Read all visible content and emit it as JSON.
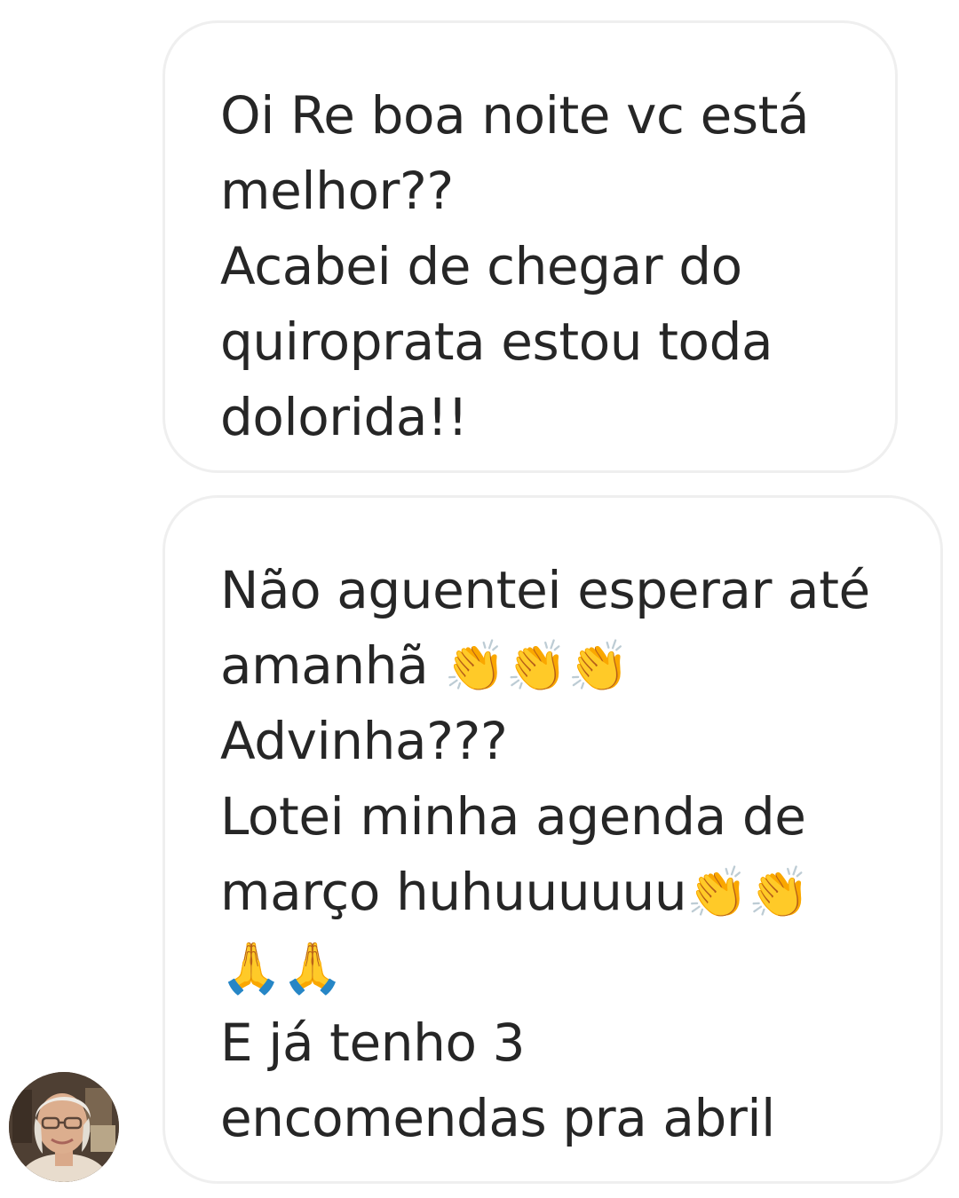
{
  "thread": {
    "messages": [
      {
        "lines": [
          "Oi Re boa noite vc está",
          "melhor??",
          "Acabei de chegar do",
          "quiroprata estou toda",
          "dolorida!!"
        ]
      },
      {
        "lines": [
          "Não aguentei esperar até",
          "amanhã",
          "Advinha???",
          "Lotei minha agenda de",
          "março huhuuuuuu",
          "",
          "E já tenho 3",
          "encomendas pra abril"
        ]
      }
    ],
    "emojis": {
      "clap_icon": "clapping-hands",
      "pray_icon": "folded-hands"
    }
  },
  "colors": {
    "bubble_border": "#efefef",
    "text": "#262626",
    "background": "#ffffff"
  }
}
